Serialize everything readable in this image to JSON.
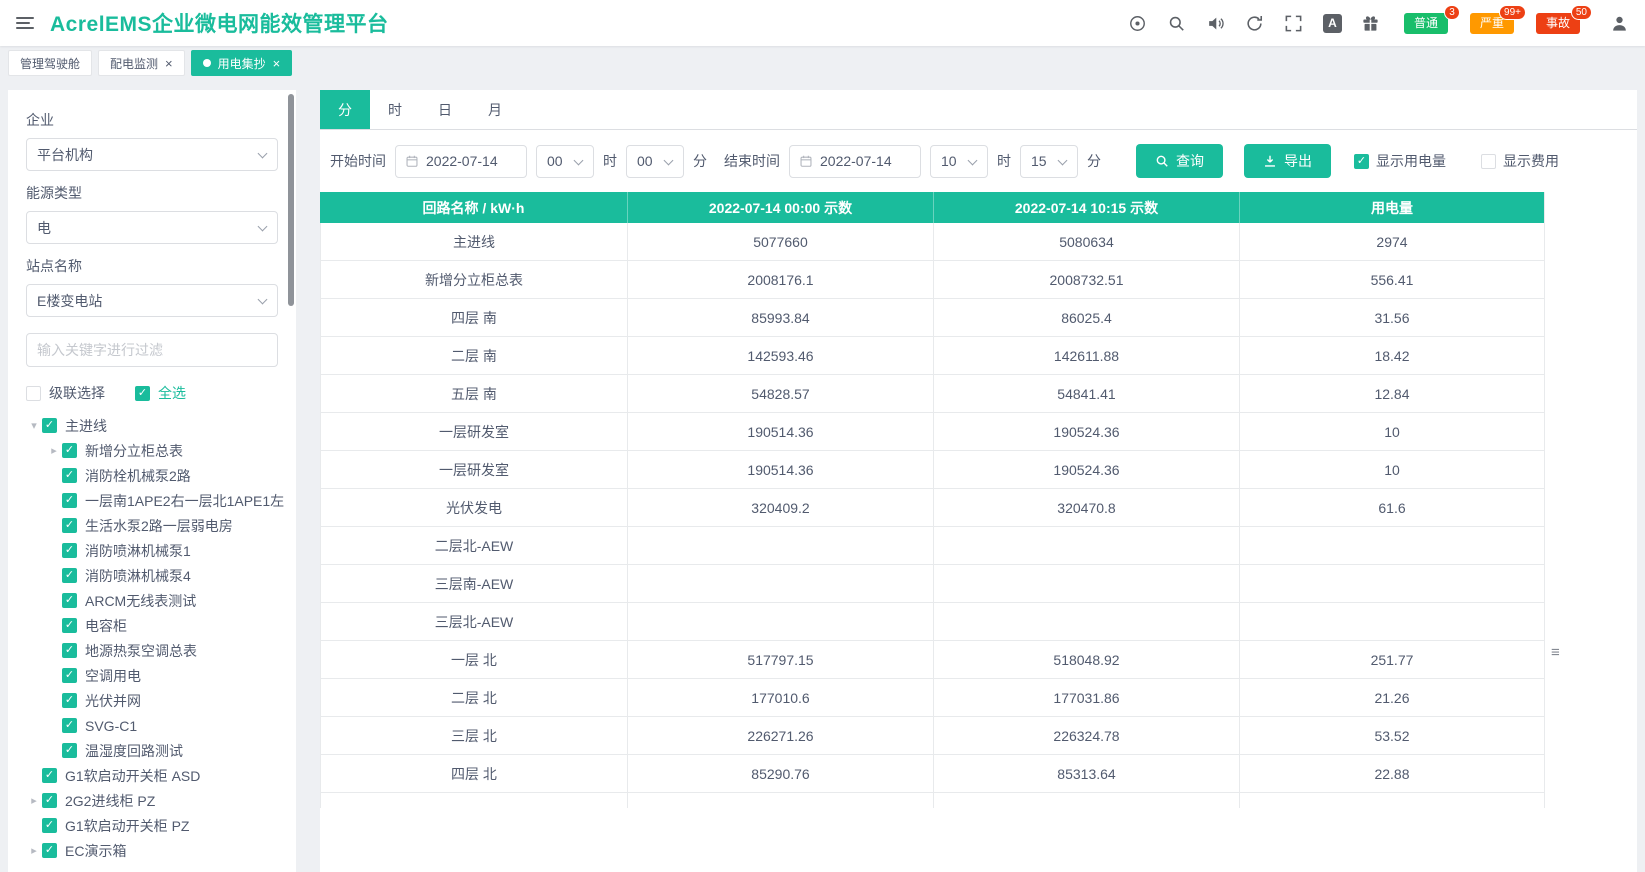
{
  "colors": {
    "accent": "#1abc9c",
    "badge_normal": "#19be6b",
    "badge_severe": "#ff9900",
    "badge_accident": "#ed4014"
  },
  "icons": {
    "close": "×",
    "check": "✓",
    "handle": "≡",
    "font_badge": "A"
  },
  "header": {
    "title": "AcrelEMS企业微电网能效管理平台",
    "alarm_badges": [
      {
        "label": "普通",
        "count": "3",
        "cls": "green"
      },
      {
        "label": "严重",
        "count": "99+",
        "cls": "orange"
      },
      {
        "label": "事故",
        "count": "50",
        "cls": "red"
      }
    ]
  },
  "window_tabs": [
    {
      "label": "管理驾驶舱",
      "cls": ""
    },
    {
      "label": "配电监测",
      "cls": "closable"
    },
    {
      "label": "用电集抄",
      "cls": "closable active"
    }
  ],
  "sidebar": {
    "fields": [
      {
        "label": "企业",
        "value": "平台机构"
      },
      {
        "label": "能源类型",
        "value": "电"
      },
      {
        "label": "站点名称",
        "value": "E楼变电站"
      }
    ],
    "filter_placeholder": "输入关键字进行过滤",
    "cascade_label": "级联选择",
    "select_all_label": "全选",
    "tree": [
      {
        "pad": "0px",
        "arrow": "▾",
        "label": "主进线"
      },
      {
        "pad": "20px",
        "arrow": "▸",
        "label": "新增分立柜总表"
      },
      {
        "pad": "20px",
        "arrow": "",
        "label": "消防栓机械泵2路"
      },
      {
        "pad": "20px",
        "arrow": "",
        "label": "一层南1APE2右一层北1APE1左"
      },
      {
        "pad": "20px",
        "arrow": "",
        "label": "生活水泵2路一层弱电房"
      },
      {
        "pad": "20px",
        "arrow": "",
        "label": "消防喷淋机械泵1"
      },
      {
        "pad": "20px",
        "arrow": "",
        "label": "消防喷淋机械泵4"
      },
      {
        "pad": "20px",
        "arrow": "",
        "label": "ARCM无线表测试"
      },
      {
        "pad": "20px",
        "arrow": "",
        "label": "电容柜"
      },
      {
        "pad": "20px",
        "arrow": "",
        "label": "地源热泵空调总表"
      },
      {
        "pad": "20px",
        "arrow": "",
        "label": "空调用电"
      },
      {
        "pad": "20px",
        "arrow": "",
        "label": "光伏并网"
      },
      {
        "pad": "20px",
        "arrow": "",
        "label": "SVG-C1"
      },
      {
        "pad": "20px",
        "arrow": "",
        "label": "温湿度回路测试"
      },
      {
        "pad": "0px",
        "arrow": "",
        "label": "G1软启动开关柜 ASD"
      },
      {
        "pad": "0px",
        "arrow": "▸",
        "label": "2G2进线柜 PZ"
      },
      {
        "pad": "0px",
        "arrow": "",
        "label": "G1软启动开关柜 PZ"
      },
      {
        "pad": "0px",
        "arrow": "▸",
        "label": "EC演示箱"
      }
    ]
  },
  "main": {
    "period_tabs": [
      {
        "label": "分",
        "cls": "active"
      },
      {
        "label": "时",
        "cls": ""
      },
      {
        "label": "日",
        "cls": ""
      },
      {
        "label": "月",
        "cls": ""
      }
    ],
    "filters": {
      "start_label": "开始时间",
      "start_date": "2022-07-14",
      "start_hour": "00",
      "start_minute": "00",
      "end_label": "结束时间",
      "end_date": "2022-07-14",
      "end_hour": "10",
      "end_minute": "15",
      "hour_unit": "时",
      "minute_unit": "分",
      "query_label": "查询",
      "export_label": "导出",
      "show_energy_label": "显示用电量",
      "show_cost_label": "显示费用"
    },
    "table": {
      "columns": [
        "回路名称 / kW·h",
        "2022-07-14 00:00 示数",
        "2022-07-14 10:15 示数",
        "用电量"
      ],
      "rows": [
        {
          "name": "主进线",
          "v1": "5077660",
          "v2": "5080634",
          "v3": "2974"
        },
        {
          "name": "新增分立柜总表",
          "v1": "2008176.1",
          "v2": "2008732.51",
          "v3": "556.41"
        },
        {
          "name": "四层 南",
          "v1": "85993.84",
          "v2": "86025.4",
          "v3": "31.56"
        },
        {
          "name": "二层 南",
          "v1": "142593.46",
          "v2": "142611.88",
          "v3": "18.42"
        },
        {
          "name": "五层 南",
          "v1": "54828.57",
          "v2": "54841.41",
          "v3": "12.84"
        },
        {
          "name": "一层研发室",
          "v1": "190514.36",
          "v2": "190524.36",
          "v3": "10"
        },
        {
          "name": "一层研发室",
          "v1": "190514.36",
          "v2": "190524.36",
          "v3": "10"
        },
        {
          "name": "光伏发电",
          "v1": "320409.2",
          "v2": "320470.8",
          "v3": "61.6"
        },
        {
          "name": "二层北-AEW",
          "v1": "",
          "v2": "",
          "v3": ""
        },
        {
          "name": "三层南-AEW",
          "v1": "",
          "v2": "",
          "v3": ""
        },
        {
          "name": "三层北-AEW",
          "v1": "",
          "v2": "",
          "v3": ""
        },
        {
          "name": "一层 北",
          "v1": "517797.15",
          "v2": "518048.92",
          "v3": "251.77"
        },
        {
          "name": "二层 北",
          "v1": "177010.6",
          "v2": "177031.86",
          "v3": "21.26"
        },
        {
          "name": "三层 北",
          "v1": "226271.26",
          "v2": "226324.78",
          "v3": "53.52"
        },
        {
          "name": "四层 北",
          "v1": "85290.76",
          "v2": "85313.64",
          "v3": "22.88"
        },
        {
          "name": "",
          "v1": "",
          "v2": "",
          "v3": ""
        }
      ]
    }
  }
}
